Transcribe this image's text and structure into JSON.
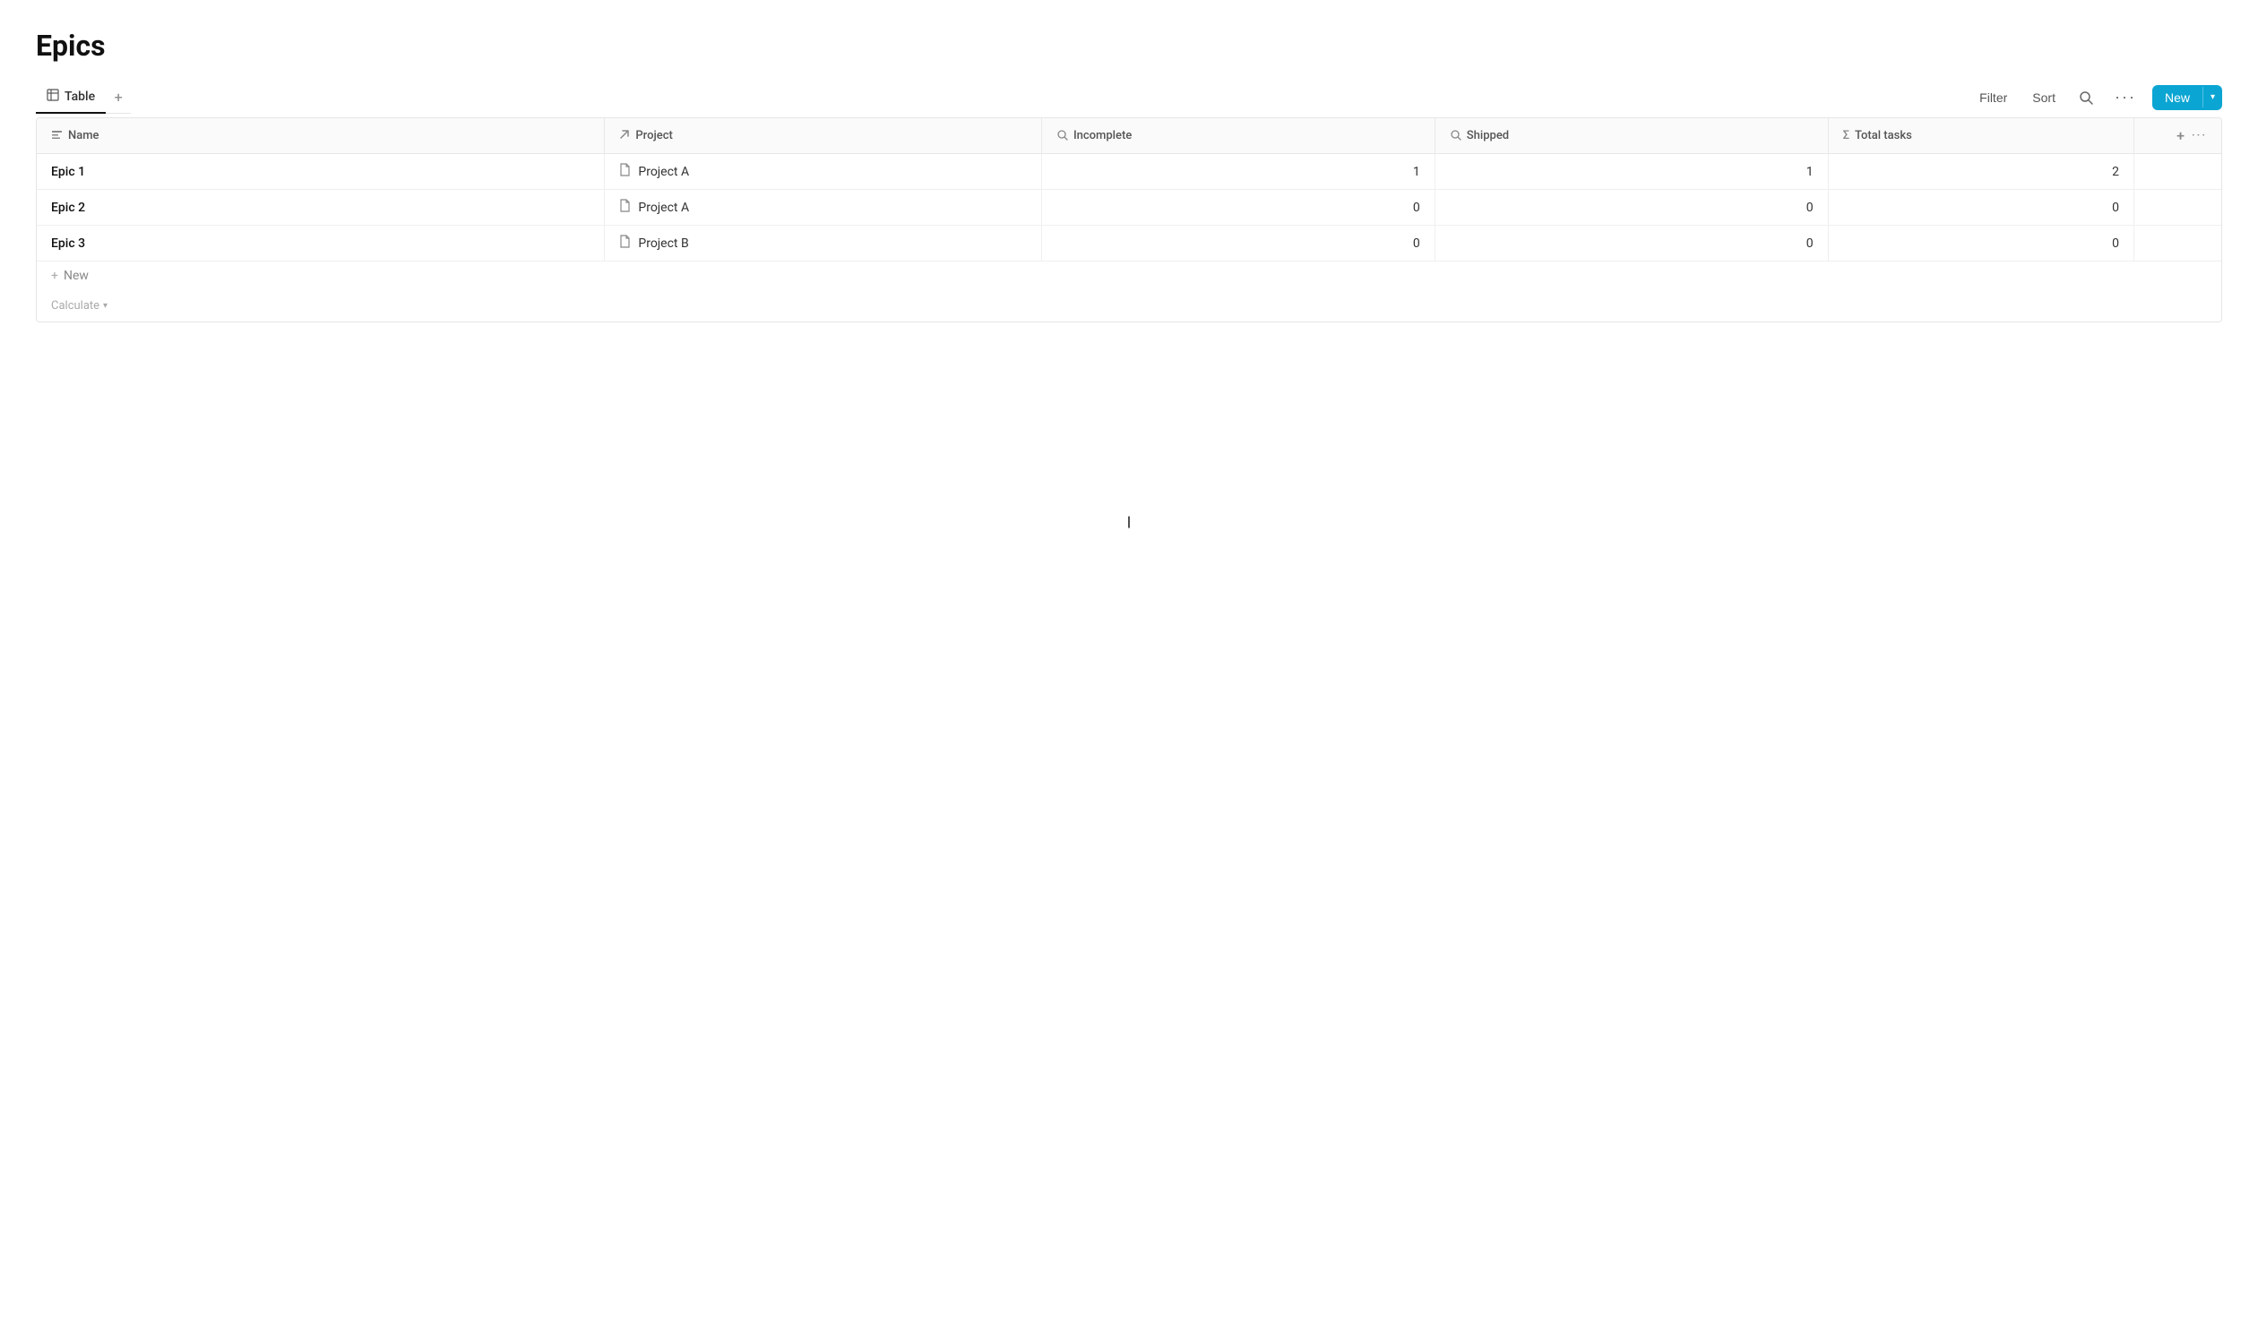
{
  "page": {
    "title": "Epics"
  },
  "tabs": [
    {
      "id": "table",
      "label": "Table",
      "active": true
    }
  ],
  "toolbar": {
    "filter_label": "Filter",
    "sort_label": "Sort",
    "new_label": "New",
    "add_view_label": "+"
  },
  "table": {
    "columns": [
      {
        "id": "name",
        "label": "Name",
        "icon": "text-icon"
      },
      {
        "id": "project",
        "label": "Project",
        "icon": "arrow-icon"
      },
      {
        "id": "incomplete",
        "label": "Incomplete",
        "icon": "search-icon"
      },
      {
        "id": "shipped",
        "label": "Shipped",
        "icon": "search-icon"
      },
      {
        "id": "total_tasks",
        "label": "Total tasks",
        "icon": "sigma-icon"
      }
    ],
    "rows": [
      {
        "id": 1,
        "name": "Epic 1",
        "project": "Project A",
        "incomplete": 1,
        "shipped": 1,
        "total_tasks": 2
      },
      {
        "id": 2,
        "name": "Epic 2",
        "project": "Project A",
        "incomplete": 0,
        "shipped": 0,
        "total_tasks": 0
      },
      {
        "id": 3,
        "name": "Epic 3",
        "project": "Project B",
        "incomplete": 0,
        "shipped": 0,
        "total_tasks": 0
      }
    ],
    "add_row_label": "New",
    "calculate_label": "Calculate"
  }
}
